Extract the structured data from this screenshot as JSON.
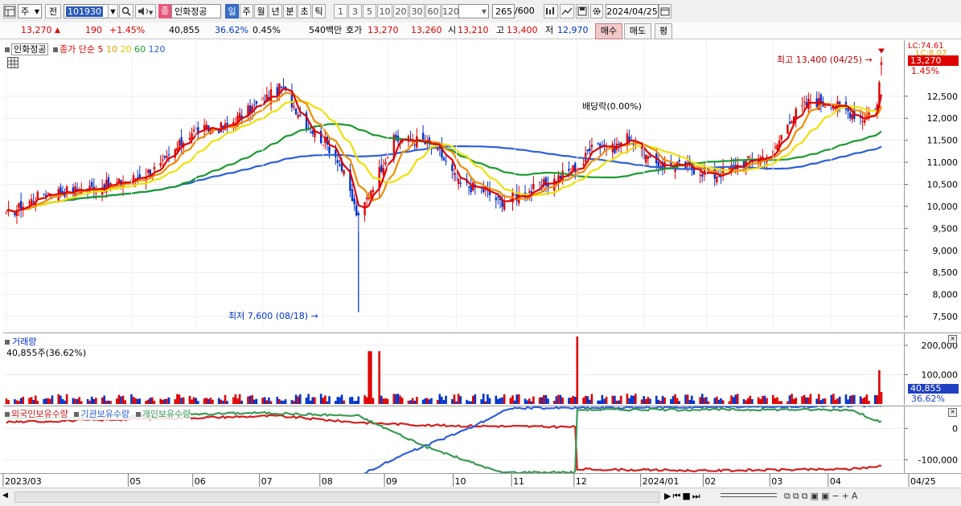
{
  "toolbar": {
    "period_label": "주",
    "prev_label": "전",
    "code_value": "101930",
    "stock_tag": "종",
    "stock_name": "인화정공",
    "tabs": [
      "일",
      "주",
      "월",
      "년",
      "분",
      "초",
      "틱"
    ],
    "intervals": [
      "1",
      "3",
      "5",
      "10",
      "20",
      "30",
      "60",
      "120"
    ],
    "count_value": "265",
    "count_total": "/600",
    "date_value": "2024/04/25"
  },
  "quote": {
    "price": "13,270",
    "change": "190",
    "change_pct": "+1.45%",
    "volume": "40,855",
    "turnover": "36.62%",
    "pct2": "0.45%",
    "amount": "540백만",
    "ask_label": "호가",
    "ask": "13,270",
    "bid": "13,260",
    "open_label": "시",
    "open": "13,210",
    "high_label": "고",
    "high": "13,400",
    "low_label": "저",
    "low": "12,970",
    "buy_label": "매수",
    "sell_label": "매도",
    "avg_label": "평"
  },
  "price_panel": {
    "name": "인화정공",
    "legend_title": "종가 단순",
    "ma": [
      "5",
      "10",
      "20",
      "60",
      "120"
    ],
    "lc_label": "LC:74.61",
    "lc2_label": "LC:8.07",
    "last_price_tag": "13,270",
    "last_pct_tag": "1.45%",
    "high_note": "최고 13,400 (04/25)",
    "low_note": "최저 7,600 (08/18)",
    "dividend_note": "배당락(0.00%)"
  },
  "volume_panel": {
    "title": "거래량",
    "summary": "40,855주(36.62%)",
    "tag_value": "40,855",
    "tag_pct": "36.62%"
  },
  "holdings_panel": {
    "legends": [
      "외국인보유수량",
      "기관보유수량",
      "개인보유수량"
    ]
  },
  "colors": {
    "up": "#e00000",
    "down": "#0033cc",
    "ma5": "#e00000",
    "ma10": "#f08c00",
    "ma20": "#f0e000",
    "ma60": "#1a9a30",
    "ma120": "#2b5fd9",
    "foreign": "#d42020",
    "institution": "#2f5fd8",
    "individual": "#3a9a55"
  },
  "chart_data": [
    {
      "type": "candlestick",
      "title": "",
      "ylim": [
        7300,
        13700
      ],
      "yticks": [
        7500,
        8000,
        8500,
        9000,
        9500,
        10000,
        10500,
        11000,
        11500,
        12000,
        12500
      ],
      "x_labels": [
        "2023/03",
        "05",
        "06",
        "07",
        "08",
        "09",
        "10",
        "11",
        "12",
        "2024/01",
        "02",
        "03",
        "04",
        "04/25"
      ],
      "close_anchors": [
        [
          "2023-03-02",
          9800
        ],
        [
          "2023-03-20",
          10300
        ],
        [
          "2023-04-10",
          10400
        ],
        [
          "2023-04-28",
          10550
        ],
        [
          "2023-05-15",
          10900
        ],
        [
          "2023-05-30",
          11700
        ],
        [
          "2023-06-15",
          11800
        ],
        [
          "2023-07-03",
          12400
        ],
        [
          "2023-07-12",
          12700
        ],
        [
          "2023-07-25",
          11800
        ],
        [
          "2023-08-01",
          11500
        ],
        [
          "2023-08-08",
          11100
        ],
        [
          "2023-08-14",
          10300
        ],
        [
          "2023-08-18",
          9700
        ],
        [
          "2023-08-24",
          10400
        ],
        [
          "2023-09-04",
          11500
        ],
        [
          "2023-09-15",
          11500
        ],
        [
          "2023-09-25",
          11300
        ],
        [
          "2023-10-05",
          10500
        ],
        [
          "2023-10-16",
          10400
        ],
        [
          "2023-10-25",
          10100
        ],
        [
          "2023-11-06",
          10300
        ],
        [
          "2023-11-20",
          10600
        ],
        [
          "2023-12-04",
          11000
        ],
        [
          "2023-12-08",
          11500
        ],
        [
          "2023-12-18",
          11300
        ],
        [
          "2023-12-26",
          11600
        ],
        [
          "2024-01-05",
          11000
        ],
        [
          "2024-01-22",
          10900
        ],
        [
          "2024-02-05",
          10700
        ],
        [
          "2024-02-19",
          11000
        ],
        [
          "2024-03-04",
          11200
        ],
        [
          "2024-03-12",
          12000
        ],
        [
          "2024-03-22",
          12400
        ],
        [
          "2024-04-03",
          12300
        ],
        [
          "2024-04-16",
          12000
        ],
        [
          "2024-04-23",
          12300
        ],
        [
          "2024-04-25",
          13270
        ]
      ],
      "extremes": {
        "high": 13400,
        "high_date": "2024-04-25",
        "low": 7600,
        "low_date": "2023-08-18"
      }
    },
    {
      "type": "bar",
      "title": "",
      "ylim": [
        0,
        230000
      ],
      "yticks": [
        100000,
        200000
      ],
      "baseline": 22000,
      "spikes": [
        [
          "2023-08-23",
          180000
        ],
        [
          "2023-08-24",
          180000
        ],
        [
          "2023-08-28",
          180000
        ],
        [
          "2023-12-01",
          230000
        ],
        [
          "2024-04-24",
          115000
        ]
      ]
    },
    {
      "type": "line",
      "title": "",
      "ylim": [
        -140000,
        60000
      ],
      "yticks": [
        0,
        -100000
      ],
      "series": [
        {
          "name": "외국인보유수량",
          "points": [
            [
              "2023-03-02",
              20000
            ],
            [
              "2023-05-01",
              30000
            ],
            [
              "2023-07-10",
              40000
            ],
            [
              "2023-08-15",
              20000
            ],
            [
              "2023-09-20",
              10000
            ],
            [
              "2023-11-20",
              5000
            ],
            [
              "2023-11-30",
              5000
            ],
            [
              "2023-12-01",
              -130000
            ],
            [
              "2024-02-01",
              -135000
            ],
            [
              "2024-04-10",
              -130000
            ],
            [
              "2024-04-25",
              -120000
            ]
          ]
        },
        {
          "name": "기관보유수량",
          "points": [
            [
              "2023-03-02",
              -150000
            ],
            [
              "2023-08-18",
              -150000
            ],
            [
              "2023-09-10",
              -80000
            ],
            [
              "2023-10-10",
              0
            ],
            [
              "2023-10-30",
              65000
            ],
            [
              "2023-11-30",
              65000
            ],
            [
              "2024-04-25",
              72000
            ]
          ]
        },
        {
          "name": "개인보유수량",
          "points": [
            [
              "2023-03-02",
              30000
            ],
            [
              "2023-07-01",
              50000
            ],
            [
              "2023-08-18",
              40000
            ],
            [
              "2023-09-20",
              -60000
            ],
            [
              "2023-10-25",
              -140000
            ],
            [
              "2023-11-30",
              -140000
            ],
            [
              "2023-12-01",
              60000
            ],
            [
              "2024-04-10",
              60000
            ],
            [
              "2024-04-25",
              20000
            ]
          ]
        }
      ]
    }
  ]
}
